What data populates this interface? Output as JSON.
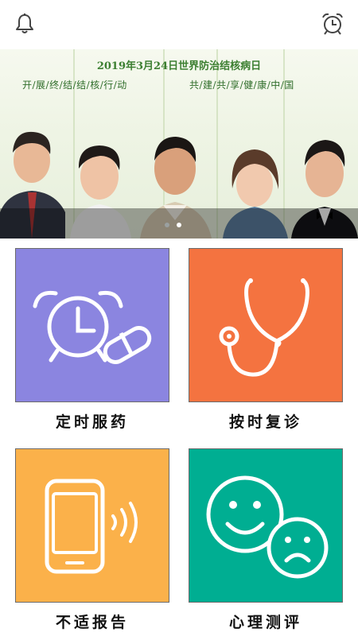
{
  "header": {
    "left_icon": "bell-icon",
    "right_icon": "alarm-clock-icon"
  },
  "banner": {
    "title": "2019年3月24日世界防治结核病日",
    "slogan_left": "开/展/终/结/结/核/行/动",
    "slogan_right": "共/建/共/享/健/康/中/国",
    "active_slide": 1,
    "slide_count": 2
  },
  "tiles": [
    {
      "label": "定时服药",
      "color": "#8b85e0",
      "icon": "alarm-clock-and-pill-icon"
    },
    {
      "label": "按时复诊",
      "color": "#f47340",
      "icon": "stethoscope-icon"
    },
    {
      "label": "不适报告",
      "color": "#fbb14a",
      "icon": "phone-ringing-icon"
    },
    {
      "label": "心理测评",
      "color": "#00ae92",
      "icon": "smiley-faces-icon"
    }
  ]
}
